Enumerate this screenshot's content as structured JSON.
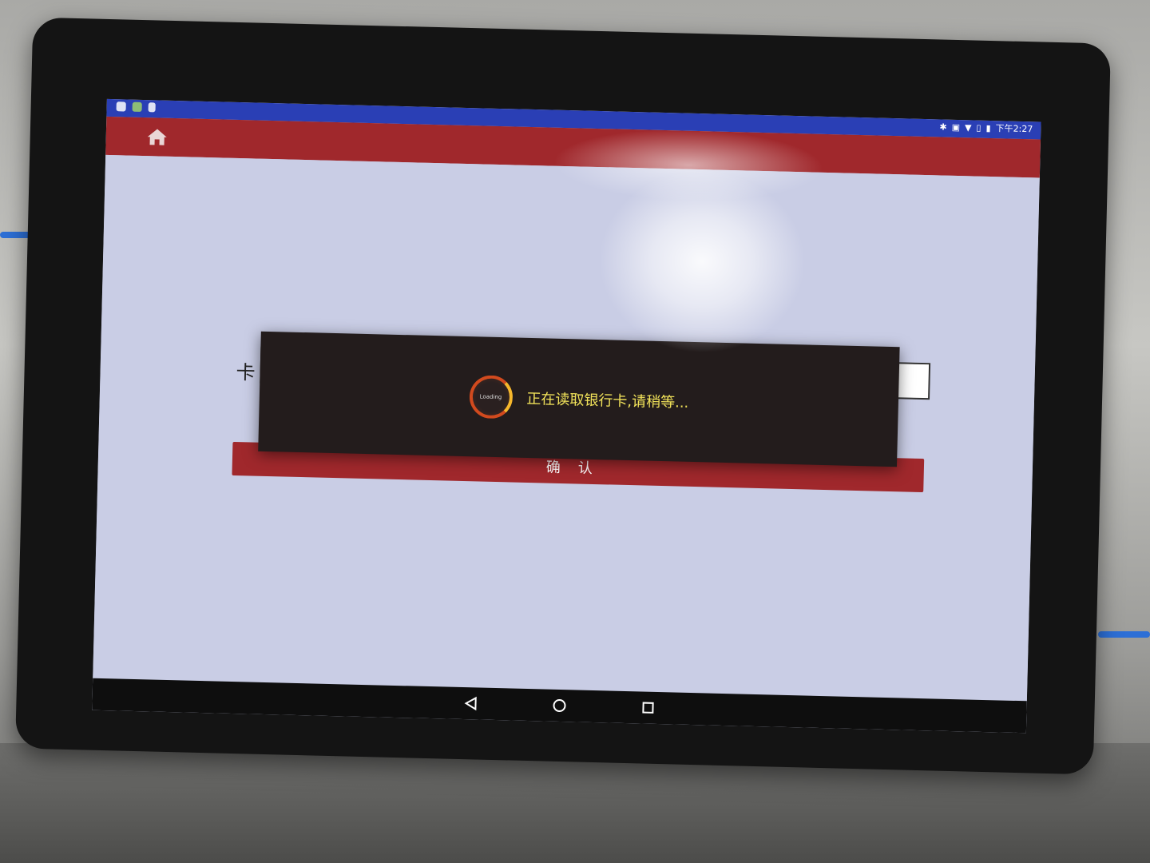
{
  "status_bar": {
    "time": "下午2:27",
    "left_icons": [
      "notification-icon",
      "image-icon",
      "lock-icon"
    ],
    "right_icons": [
      "bluetooth-icon",
      "vibrate-icon",
      "wifi-icon",
      "sim-icon",
      "battery-icon"
    ]
  },
  "app_bar": {
    "home_icon": "home-icon",
    "color": "#a0282c"
  },
  "form": {
    "card_label": "卡",
    "card_value": ""
  },
  "confirm_button": {
    "label": "确认"
  },
  "loading_dialog": {
    "spinner_text": "Loading",
    "message": "正在读取银行卡,请稍等..."
  },
  "nav_bar": {
    "buttons": [
      "back-icon",
      "home-circle-icon",
      "recents-icon"
    ]
  }
}
